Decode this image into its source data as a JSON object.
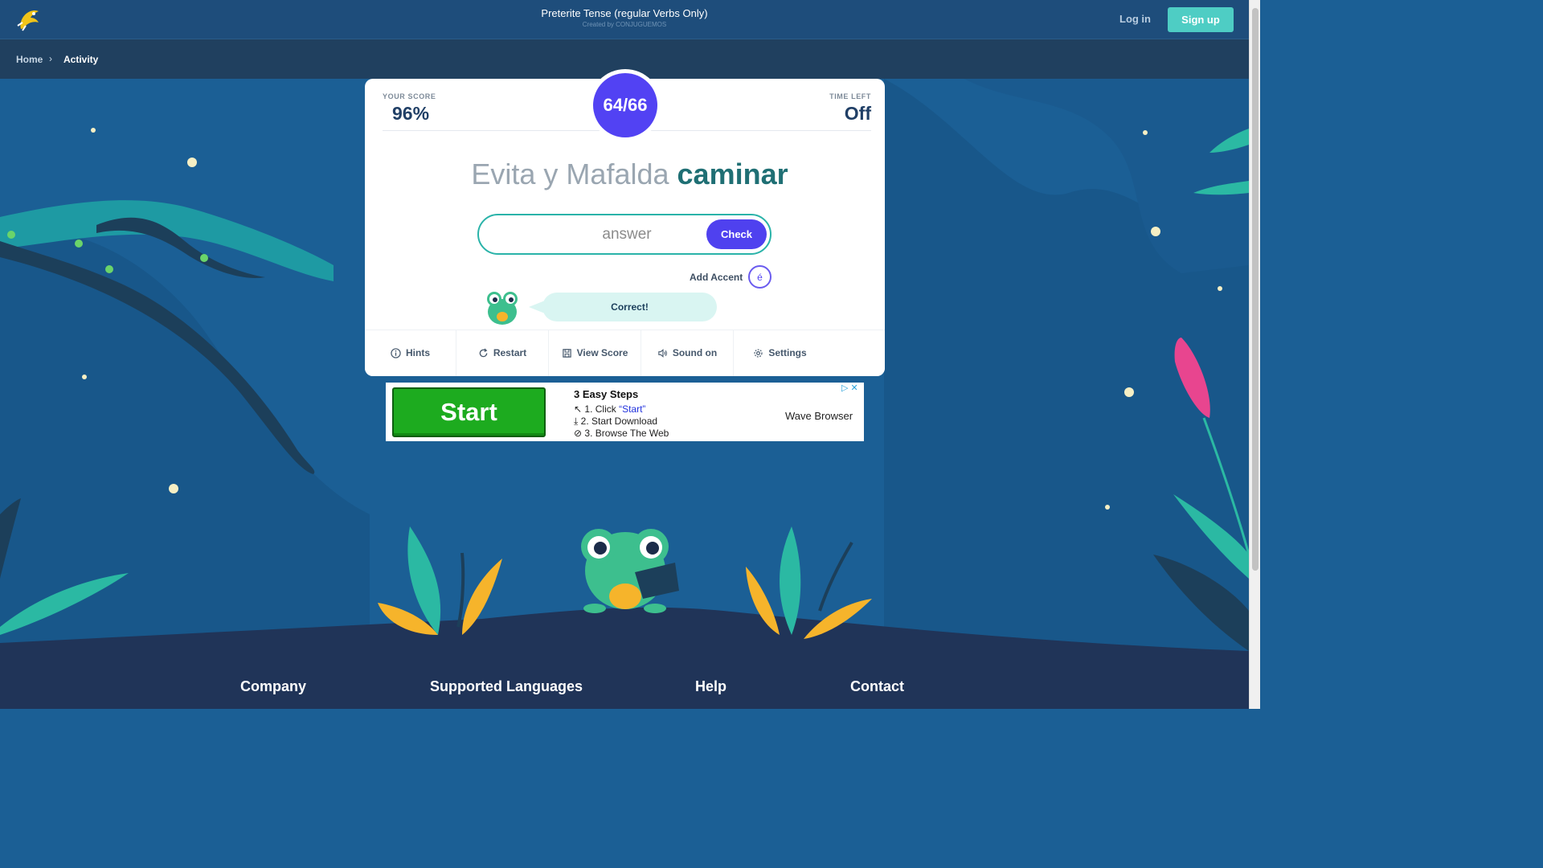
{
  "header": {
    "title": "Preterite Tense (regular Verbs Only)",
    "subtitle": "Created by CONJUGUEMOS",
    "login_label": "Log in",
    "signup_label": "Sign up"
  },
  "breadcrumb": {
    "home": "Home",
    "separator": "›",
    "current": "Activity"
  },
  "activity": {
    "score_label": "YOUR SCORE",
    "score_value": "96%",
    "progress": "64/66",
    "time_label": "TIME LEFT",
    "time_value": "Off",
    "prompt_subject": "Evita y Mafalda",
    "prompt_verb": "caminar",
    "answer_placeholder": "answer",
    "check_label": "Check",
    "add_accent_label": "Add Accent",
    "accent_char": "é",
    "feedback": "Correct!"
  },
  "toolbar": {
    "hints": "Hints",
    "restart": "Restart",
    "view_score": "View Score",
    "sound": "Sound on",
    "settings": "Settings"
  },
  "ad": {
    "start_label": "Start",
    "steps_title": "3 Easy Steps",
    "step1_prefix": "1. Click ",
    "step1_link": "“Start”",
    "step2": "2.  Start Download",
    "step3": "3.  Browse The Web",
    "brand": "Wave Browser",
    "close": "▷ ✕"
  },
  "footer": {
    "company": "Company",
    "languages": "Supported Languages",
    "help": "Help",
    "contact": "Contact"
  },
  "colors": {
    "accent": "#5242f3",
    "teal": "#4ecdc4",
    "background": "#1b5f95",
    "header": "#1e4d7b"
  }
}
